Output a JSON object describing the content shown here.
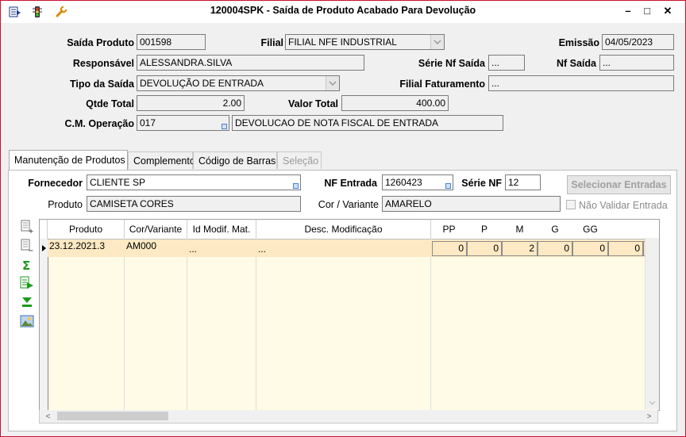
{
  "window": {
    "title": "120004SPK - Saída de Produto Acabado Para Devolução",
    "controls": {
      "minimize": "–",
      "maximize": "□",
      "close": "✕"
    },
    "titlebar_icons": [
      "menu-icon",
      "traffic-light-icon",
      "wrench-icon"
    ]
  },
  "header": {
    "saida_produto": {
      "label": "Saída Produto",
      "value": "001598"
    },
    "filial": {
      "label": "Filial",
      "value": "FILIAL NFE INDUSTRIAL"
    },
    "emissao": {
      "label": "Emissão",
      "value": "04/05/2023"
    },
    "responsavel": {
      "label": "Responsável",
      "value": "ALESSANDRA.SILVA"
    },
    "serie_nf_saida": {
      "label": "Série Nf Saída",
      "value": "..."
    },
    "nf_saida": {
      "label": "Nf Saída",
      "value": "..."
    },
    "tipo_saida": {
      "label": "Tipo da Saída",
      "value": "DEVOLUÇÃO DE ENTRADA"
    },
    "filial_faturamento": {
      "label": "Filial Faturamento",
      "value": "..."
    },
    "qtde_total": {
      "label": "Qtde Total",
      "value": "2.00"
    },
    "valor_total": {
      "label": "Valor Total",
      "value": "400.00"
    },
    "cm_operacao": {
      "label": "C.M. Operação",
      "code": "017",
      "description": "DEVOLUCAO DE NOTA FISCAL DE ENTRADA"
    }
  },
  "tabs": [
    {
      "label": "Manutenção de Produtos",
      "active": true,
      "enabled": true
    },
    {
      "label": "Complemento",
      "active": false,
      "enabled": true
    },
    {
      "label": "Código de Barras",
      "active": false,
      "enabled": true
    },
    {
      "label": "Seleção",
      "active": false,
      "enabled": false
    }
  ],
  "products_tab": {
    "fornecedor": {
      "label": "Fornecedor",
      "value": "CLIENTE SP"
    },
    "nf_entrada": {
      "label": "NF Entrada",
      "value": "1260423"
    },
    "serie_nf": {
      "label": "Série NF",
      "value": "12"
    },
    "selecionar_entradas": "Selecionar Entradas",
    "produto": {
      "label": "Produto",
      "value": "CAMISETA CORES"
    },
    "cor_variante": {
      "label": "Cor / Variante",
      "value": "AMARELO"
    },
    "nao_validar_entrada": {
      "label": "Não Validar Entrada",
      "checked": false
    }
  },
  "side_toolbar": [
    "add-row-icon",
    "remove-row-icon",
    "sum-icon",
    "export-icon",
    "download-icon",
    "image-icon"
  ],
  "grid": {
    "columns": [
      "Produto",
      "Cor/Variante",
      "Id Modif. Mat.",
      "Desc. Modificação",
      "PP",
      "P",
      "M",
      "G",
      "GG"
    ],
    "rows": [
      {
        "produto": "23.12.2021.3",
        "cor": "AM000",
        "id_modif": "...",
        "desc_modif": "...",
        "pp": "0",
        "p": "0",
        "m": "2",
        "g": "0",
        "gg": "0",
        "extra": "0"
      }
    ]
  },
  "colors": {
    "accent_border": "#c8102e",
    "selected_row": "#fde9c3",
    "grid_bg": "#fffbe6"
  }
}
